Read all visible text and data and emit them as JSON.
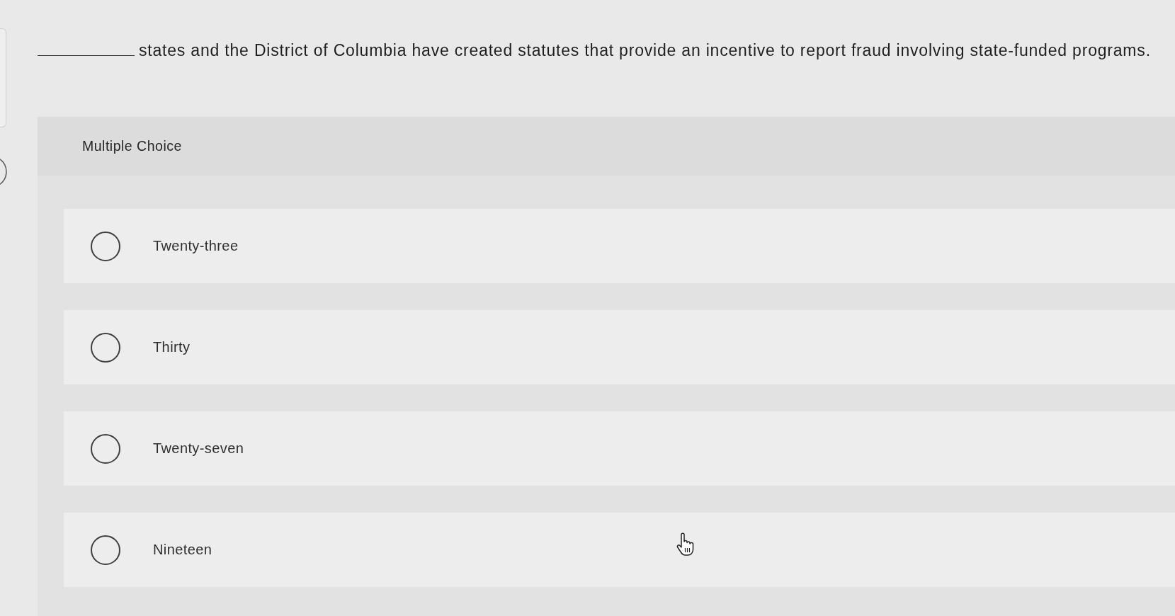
{
  "question": {
    "text": "states and the District of Columbia have created statutes that provide an incentive to report fraud involving state-funded programs."
  },
  "answer_panel": {
    "type_label": "Multiple Choice",
    "options": [
      {
        "label": "Twenty-three",
        "selected": false
      },
      {
        "label": "Thirty",
        "selected": false
      },
      {
        "label": "Twenty-seven",
        "selected": false
      },
      {
        "label": "Nineteen",
        "selected": false
      }
    ]
  }
}
